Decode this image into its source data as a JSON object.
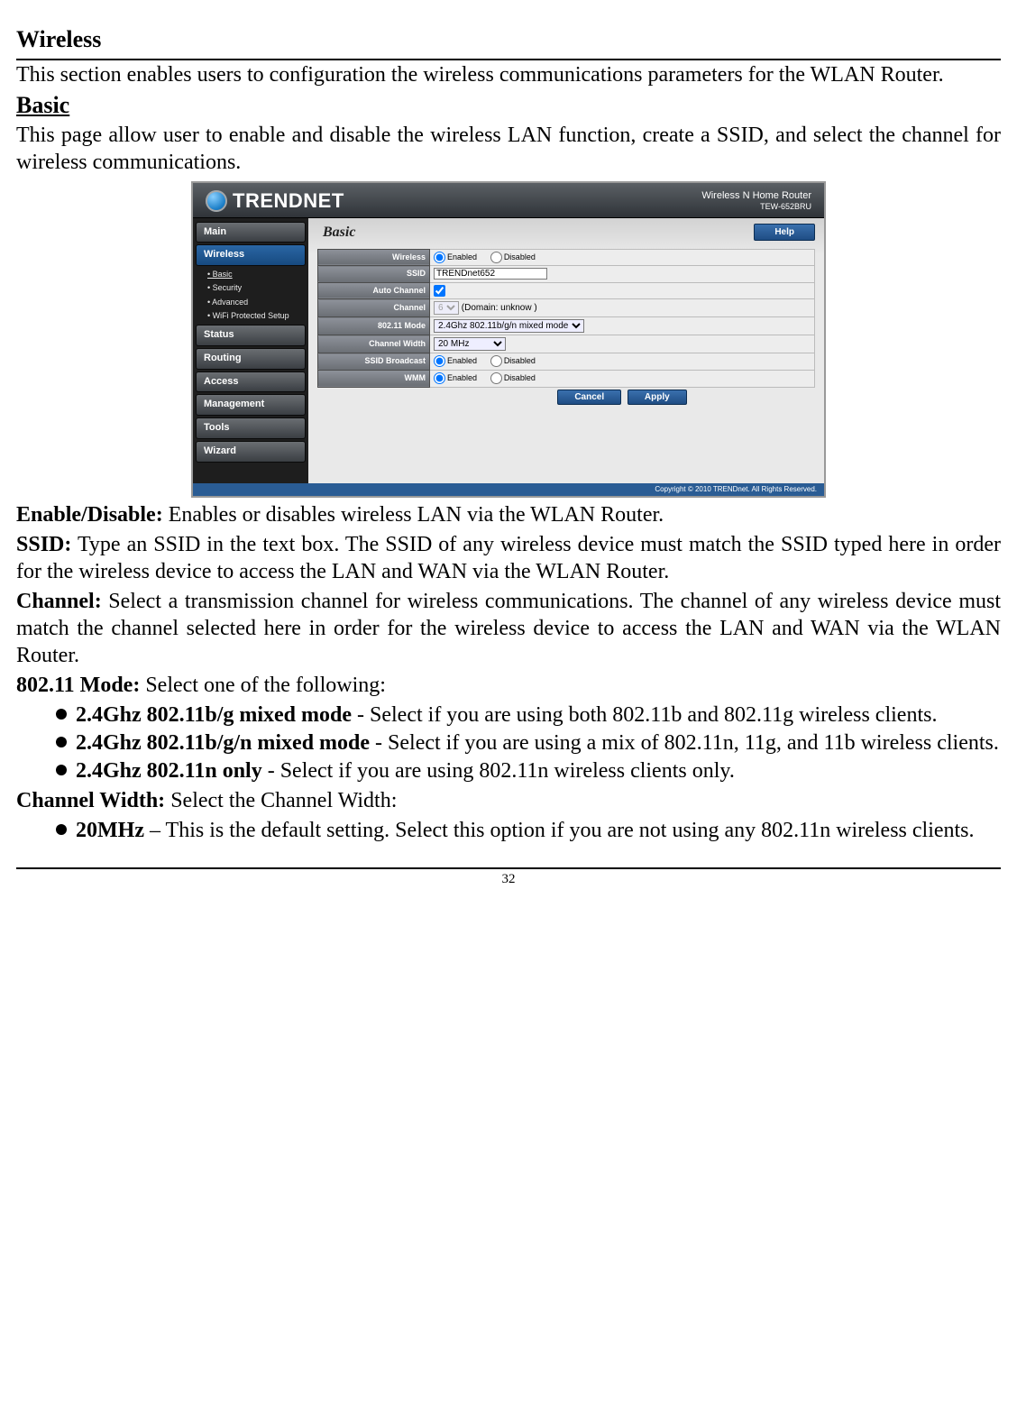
{
  "page_number": "32",
  "doc": {
    "title_wireless": "Wireless",
    "intro": "This section enables users to configuration the wireless communications parameters for the WLAN Router.",
    "title_basic": "Basic",
    "basic_intro": "This page allow user to enable and disable the wireless LAN function, create a SSID, and select the channel for wireless communications.",
    "enable_disable_label": "Enable/Disable:",
    "enable_disable_text": " Enables or disables wireless LAN via the WLAN Router.",
    "ssid_label": "SSID:",
    "ssid_text": " Type an SSID in the text box. The SSID of any wireless device must match the SSID typed here in order for the wireless device to access the LAN and WAN via the WLAN Router.",
    "channel_label": "Channel:",
    "channel_text": " Select a transmission channel for wireless communications. The channel of any wireless device must match the channel selected here in order for the wireless device to access the LAN and WAN via the WLAN Router.",
    "mode_label": "802.11 Mode:",
    "mode_text": " Select one of the following:",
    "bullet1_b": "2.4Ghz 802.11b/g mixed mode",
    "bullet1_t": " - Select if you are using both 802.11b and 802.11g wireless clients.",
    "bullet2_b": "2.4Ghz 802.11b/g/n mixed mode",
    "bullet2_t": " - Select if you are using a mix of 802.11n, 11g, and 11b wireless clients.",
    "bullet3_b": "2.4Ghz 802.11n only",
    "bullet3_t": " - Select if you are using 802.11n wireless clients only.",
    "cw_label": "Channel Width:",
    "cw_text": " Select the Channel Width:",
    "cw_b1_b": "20MHz",
    "cw_b1_t": " – This is the default setting. Select this option if you are not using any 802.11n wireless clients."
  },
  "router": {
    "brand": "TRENDNET",
    "model_line1": "Wireless N Home Router",
    "model_line2": "TEW-652BRU",
    "nav": {
      "main": "Main",
      "wireless": "Wireless",
      "sub_basic": "• Basic",
      "sub_security": "• Security",
      "sub_advanced": "• Advanced",
      "sub_wps": "• WiFi Protected Setup",
      "status": "Status",
      "routing": "Routing",
      "access": "Access",
      "management": "Management",
      "tools": "Tools",
      "wizard": "Wizard"
    },
    "panel": {
      "title": "Basic",
      "help": "Help",
      "rows": {
        "wireless": "Wireless",
        "ssid": "SSID",
        "auto_channel": "Auto Channel",
        "channel": "Channel",
        "mode": "802.11 Mode",
        "cw": "Channel Width",
        "broadcast": "SSID Broadcast",
        "wmm": "WMM"
      },
      "values": {
        "ssid": "TRENDnet652",
        "channel_sel": "6",
        "channel_domain": "(Domain: unknow )",
        "mode_sel": "2.4Ghz 802.11b/g/n mixed mode",
        "cw_sel": "20 MHz",
        "enabled": "Enabled",
        "disabled": "Disabled"
      },
      "buttons": {
        "cancel": "Cancel",
        "apply": "Apply"
      }
    },
    "footer": "Copyright © 2010 TRENDnet. All Rights Reserved."
  }
}
